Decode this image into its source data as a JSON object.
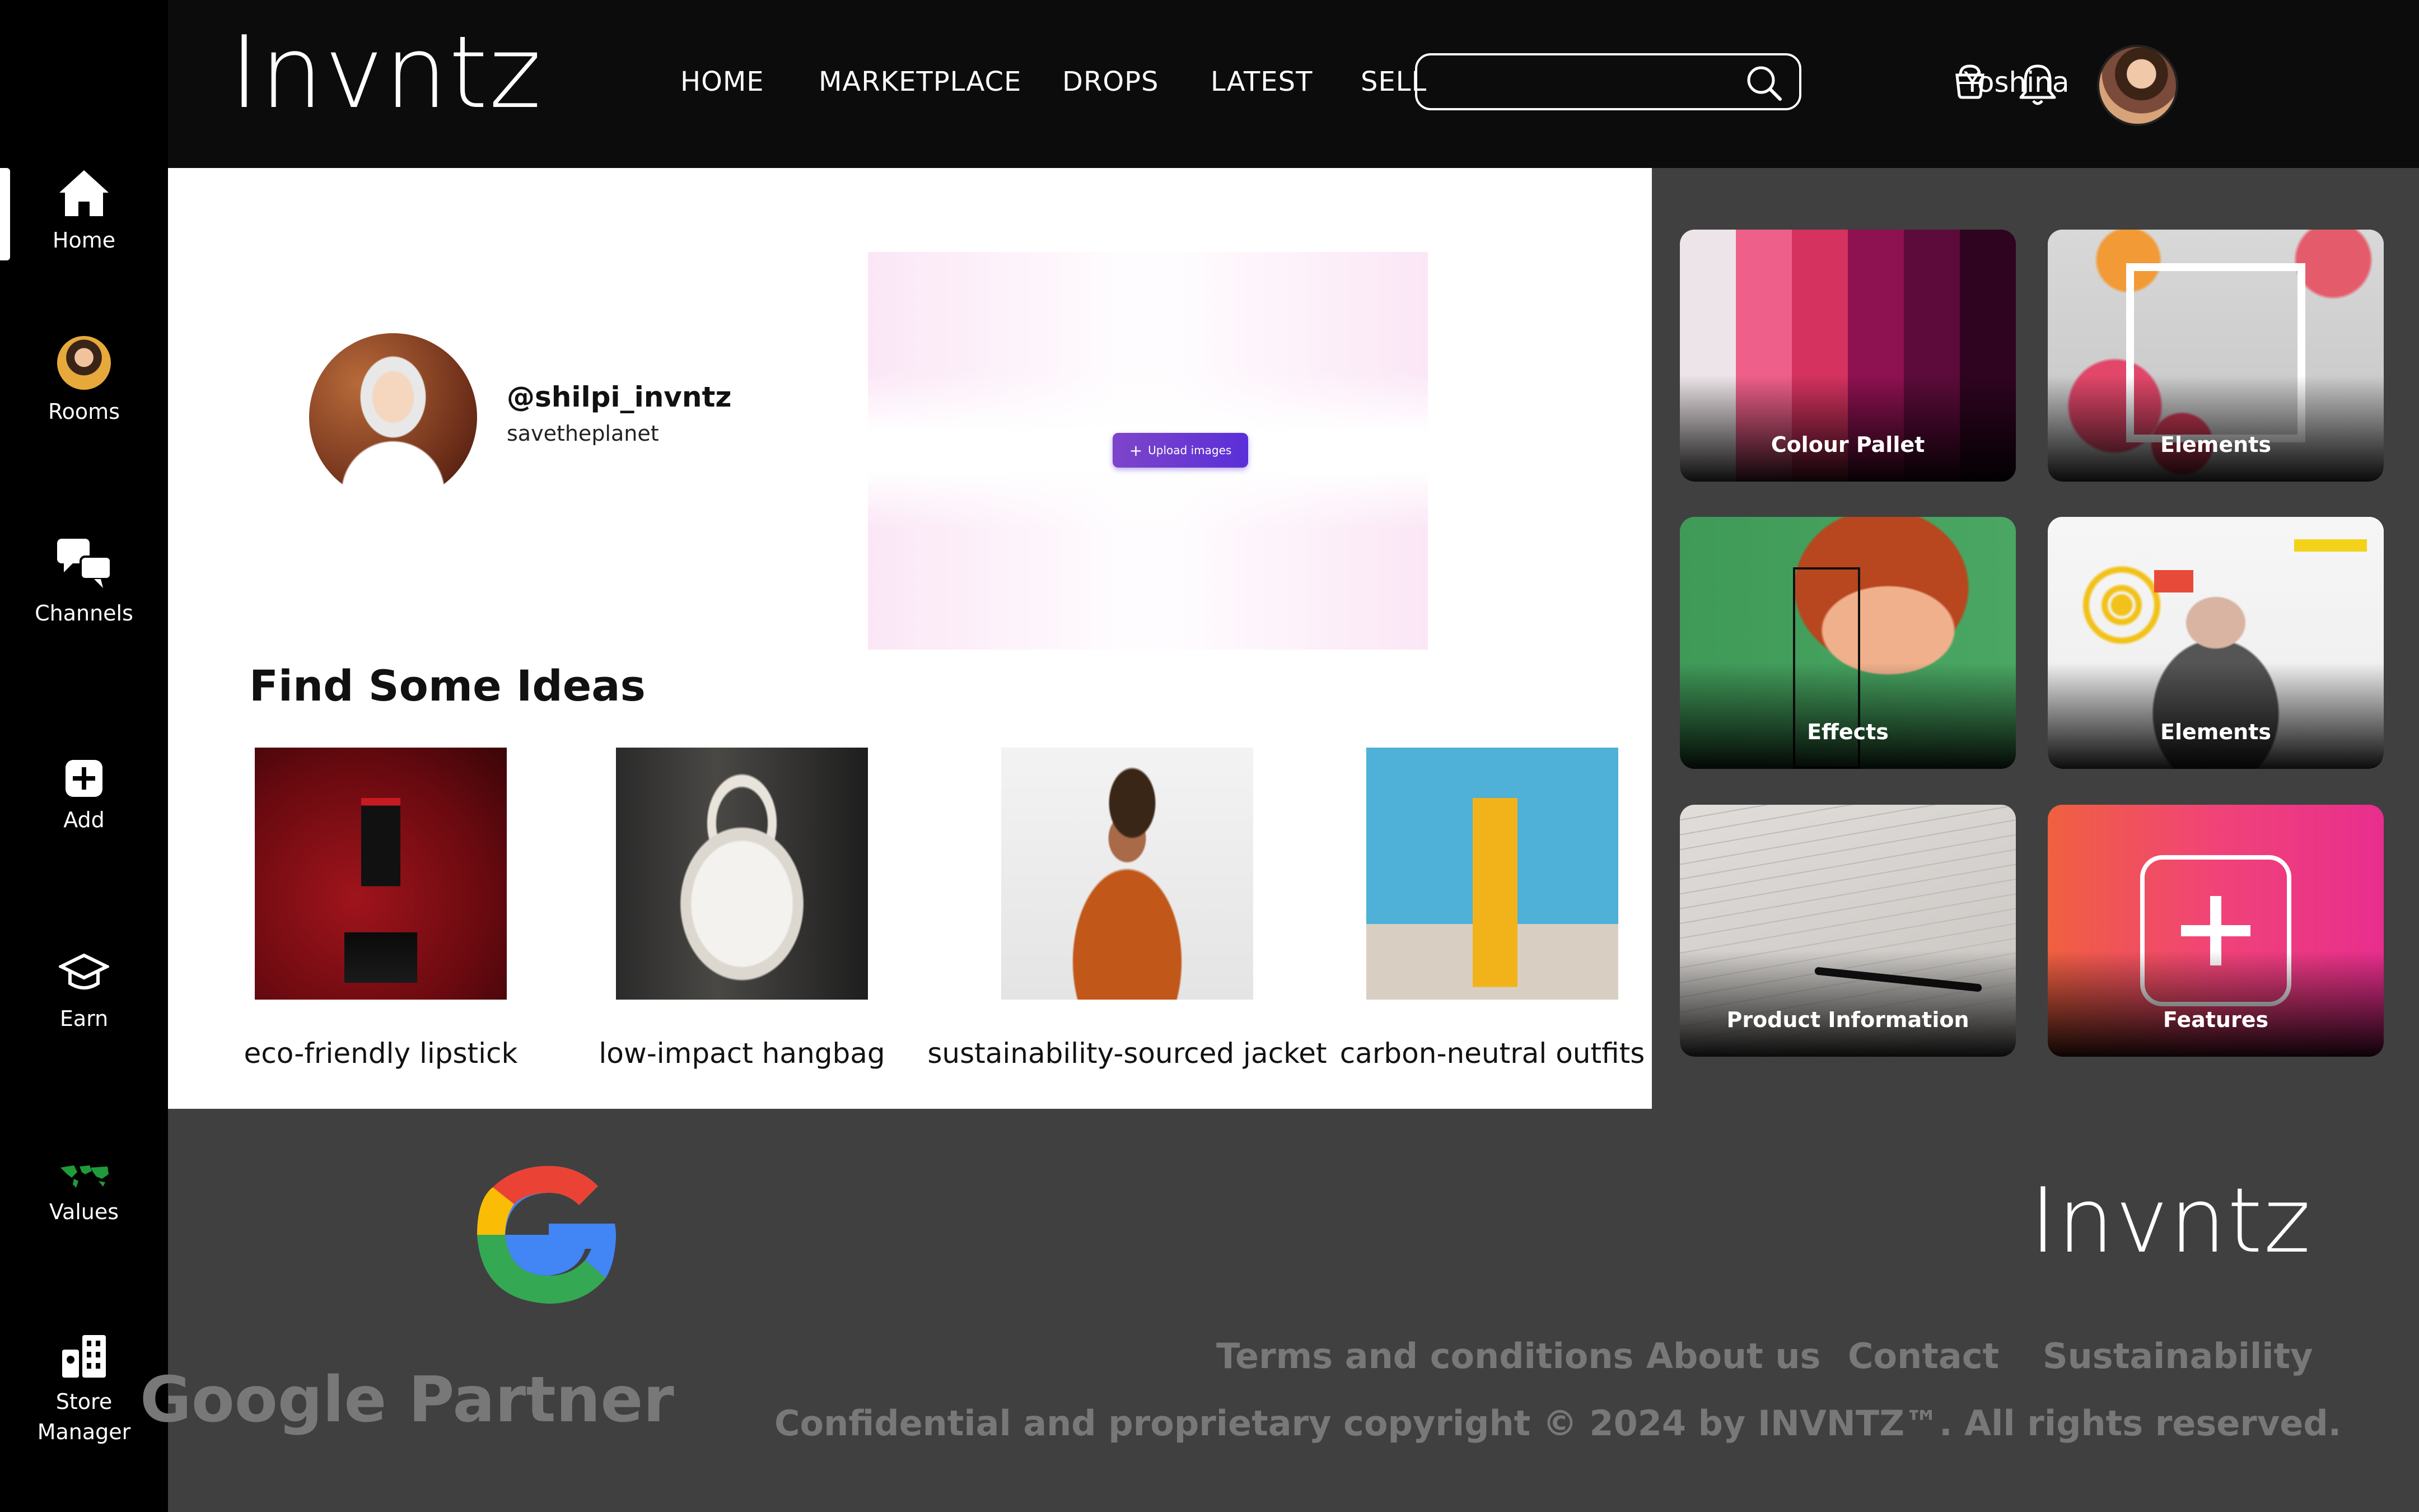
{
  "app": {
    "logo": "Invntz"
  },
  "sidebar": {
    "items": [
      {
        "label": "Home",
        "icon": "home-icon",
        "active": true
      },
      {
        "label": "Rooms",
        "icon": "avatar-icon"
      },
      {
        "label": "Channels",
        "icon": "chat-bubbles-icon"
      },
      {
        "label": "Add",
        "icon": "plus-square-icon"
      },
      {
        "label": "Earn",
        "icon": "graduation-cap-icon"
      },
      {
        "label": "Values",
        "icon": "world-map-icon"
      },
      {
        "label": "Store\nManager",
        "icon": "store-manager-icon"
      }
    ]
  },
  "header": {
    "nav": [
      "HOME",
      "MARKETPLACE",
      "DROPS",
      "LATEST",
      "SELL"
    ],
    "search": {
      "placeholder": "",
      "icon": "search-icon"
    },
    "cart_icon": "basket-icon",
    "bell_icon": "bell-icon",
    "user_name": "Yoshina"
  },
  "profile": {
    "handle": "@shilpi_invntz",
    "tagline": "savetheplanet",
    "upload_label": "Upload images"
  },
  "ideas": {
    "title": "Find Some Ideas",
    "items": [
      {
        "caption": "eco-friendly lipstick"
      },
      {
        "caption": "low-impact hangbag"
      },
      {
        "caption": "sustainability-sourced jacket"
      },
      {
        "caption": "carbon-neutral outfits"
      }
    ]
  },
  "tools": {
    "cards": [
      {
        "title": "Colour Pallet",
        "palette": [
          "#e8e0e4",
          "#ee5f8a",
          "#d5325f",
          "#8e1151",
          "#5c0b3a",
          "#2f0420"
        ]
      },
      {
        "title": "Elements"
      },
      {
        "title": "Effects"
      },
      {
        "title": "Elements"
      },
      {
        "title": "Product Information"
      },
      {
        "title": "Features"
      }
    ]
  },
  "footer": {
    "partner": "Google Partner",
    "logo": "Invntz",
    "links": [
      "Terms and conditions",
      "About us",
      "Contact",
      "Sustainability"
    ],
    "copyright": "Confidential and proprietary copyright © 2024 by INVNTZ™. All rights reserved."
  },
  "colors": {
    "background": "#000000",
    "panel": "#404040",
    "accent": "#5a2fd8",
    "muted_text": "#787878"
  }
}
